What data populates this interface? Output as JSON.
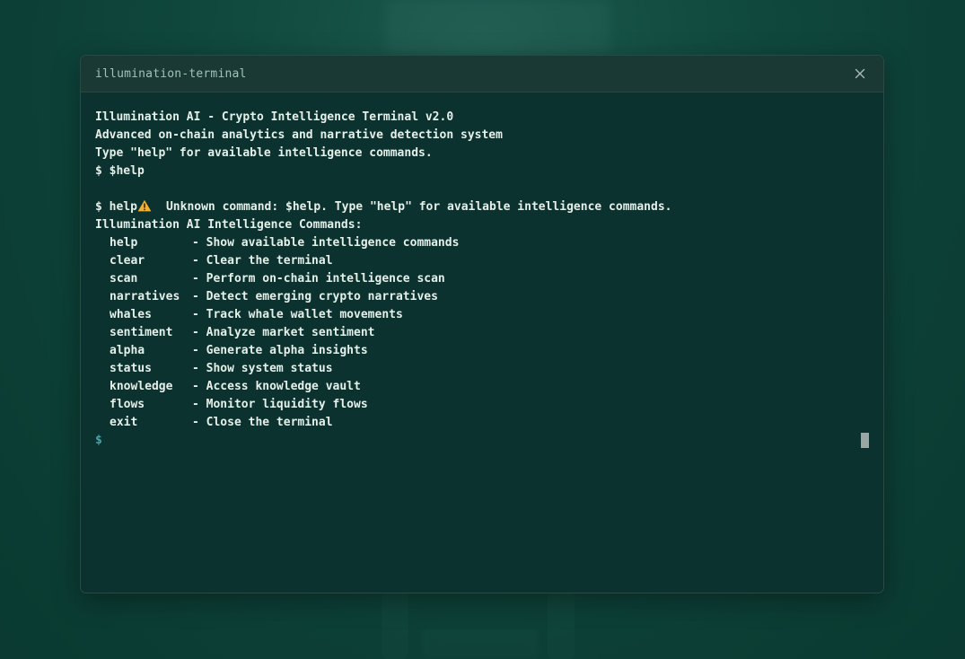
{
  "window": {
    "title": "illumination-terminal"
  },
  "output": {
    "intro": [
      "Illumination AI - Crypto Intelligence Terminal v2.0",
      "Advanced on-chain analytics and narrative detection system",
      "Type \"help\" for available intelligence commands."
    ],
    "history_1": "$ $help",
    "warning": "Unknown command: $help. Type \"help\" for available intelligence commands.",
    "history_2": "$ help",
    "commands_header": "Illumination AI Intelligence Commands:",
    "commands": [
      {
        "name": "help",
        "desc": "- Show available intelligence commands"
      },
      {
        "name": "clear",
        "desc": "- Clear the terminal"
      },
      {
        "name": "scan",
        "desc": "- Perform on-chain intelligence scan"
      },
      {
        "name": "narratives",
        "desc": "- Detect emerging crypto narratives"
      },
      {
        "name": "whales",
        "desc": "- Track whale wallet movements"
      },
      {
        "name": "sentiment",
        "desc": "- Analyze market sentiment"
      },
      {
        "name": "alpha",
        "desc": "- Generate alpha insights"
      },
      {
        "name": "status",
        "desc": "- Show system status"
      },
      {
        "name": "knowledge",
        "desc": "- Access knowledge vault"
      },
      {
        "name": "flows",
        "desc": "- Monitor liquidity flows"
      },
      {
        "name": "exit",
        "desc": "- Close the terminal"
      }
    ]
  },
  "prompt": {
    "symbol": "$",
    "value": ""
  },
  "icons": {
    "close": "close-icon",
    "warning": "warning-icon"
  },
  "colors": {
    "background": "#0c3f36",
    "terminal_bg": "#0b322e",
    "titlebar_bg": "#1a3935",
    "text": "#e6efe9",
    "prompt": "#4aa3a8",
    "warning": "#f2b134"
  }
}
